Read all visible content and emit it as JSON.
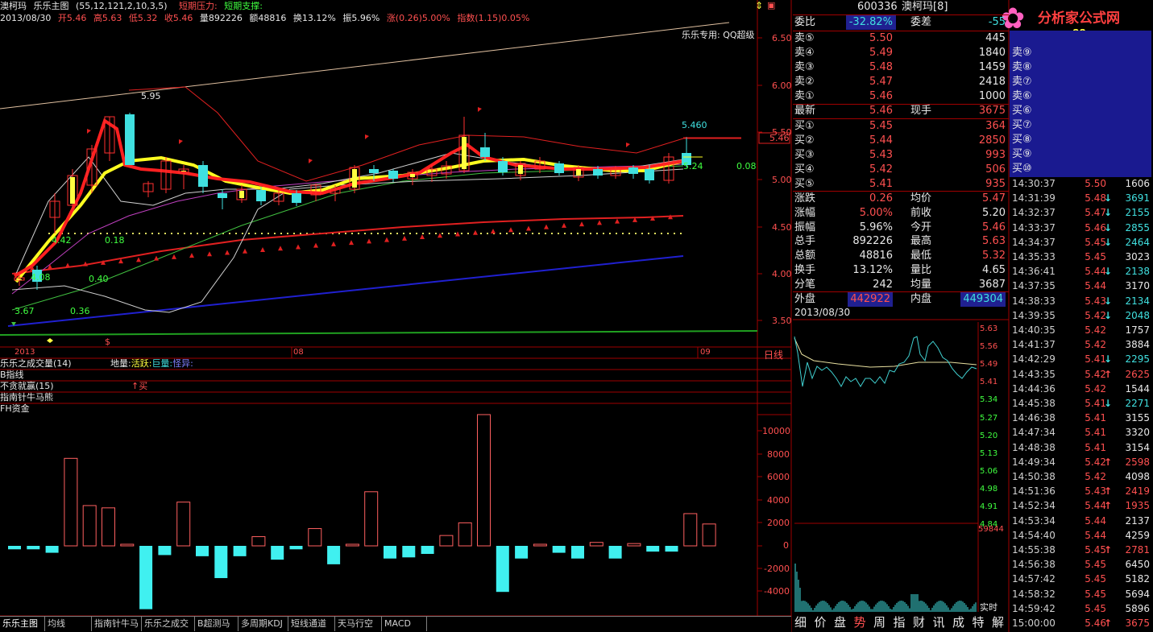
{
  "header": {
    "stock_name": "澳柯玛",
    "indicator_name": "乐乐主图",
    "params": "(55,12,121,2,10,3,5)",
    "pressure": "短期压力:",
    "support": "短期支撑:",
    "date": "2013/08/30",
    "open": "开5.46",
    "high": "高5.63",
    "low": "低5.32",
    "close": "收5.46",
    "volume": "量892226",
    "amount": "额48816",
    "turnover": "换13.12%",
    "swing": "振5.96%",
    "change": "涨(0.26)5.00%",
    "index": "指数(1.15)0.05%"
  },
  "main_chart": {
    "special_label": "乐乐专用: QQ超级",
    "y_ticks": [
      "6.50",
      "6.00",
      "5.50",
      "5.00",
      "4.50",
      "4.00",
      "3.50"
    ],
    "price_tags": {
      "high": "5.95",
      "low": "3.67",
      "last": "5.460",
      "cur_marker": "5.46",
      "right_val": "5.24",
      "green_val": "0.08"
    },
    "bottom_labels": {
      "lbl1": "0.18",
      "lbl2": "0.40",
      "lbl3": "0.36",
      "lbl4": "4.08",
      "lbl5": "4.42"
    },
    "x_labels": [
      "2013",
      "08",
      "09"
    ],
    "dayline": "日线"
  },
  "indicators": {
    "vol_title": "乐乐之成交量(14)",
    "vol_sub": [
      "地量:",
      "活跃:",
      "巨量:",
      "怪异:"
    ],
    "b_line": "B指线",
    "no_greedy": "不贪就赢(15)",
    "buy_mark": "↑买",
    "zhinan": "指南针牛马熊",
    "fh": "FH资金",
    "y_ticks": [
      "10000",
      "8000",
      "6000",
      "4000",
      "2000",
      "0",
      "-2000",
      "-4000"
    ]
  },
  "chart_data": {
    "type": "bar",
    "title": "乐乐之成交量(14)",
    "ylim": [
      -5500,
      12000
    ],
    "values": [
      -300,
      -300,
      -600,
      7600,
      3500,
      3300,
      0,
      -5500,
      -800,
      3800,
      -900,
      -2800,
      -900,
      800,
      -1200,
      -300,
      1500,
      -1600,
      100,
      4700,
      -1100,
      -1000,
      -700,
      900,
      2000,
      11400,
      -4000,
      -1100,
      0,
      -600,
      -1100,
      300,
      -1100,
      200,
      -500,
      -500,
      2800,
      1900
    ]
  },
  "order_book": {
    "code": "600336",
    "name": "澳柯玛[8]",
    "wb_label": "委比",
    "wb_val": "-32.82%",
    "wc_label": "委差",
    "wc_val": "-55",
    "sells": [
      {
        "l": "卖⑤",
        "p": "5.50",
        "v": "445"
      },
      {
        "l": "卖④",
        "p": "5.49",
        "v": "1840"
      },
      {
        "l": "卖③",
        "p": "5.48",
        "v": "1459"
      },
      {
        "l": "卖②",
        "p": "5.47",
        "v": "2418"
      },
      {
        "l": "卖①",
        "p": "5.46",
        "v": "1000"
      }
    ],
    "last": {
      "l": "最新",
      "p": "5.46",
      "m": "现手",
      "v": "3675"
    },
    "buys": [
      {
        "l": "买①",
        "p": "5.45",
        "v": "364"
      },
      {
        "l": "买②",
        "p": "5.44",
        "v": "2850"
      },
      {
        "l": "买③",
        "p": "5.43",
        "v": "993"
      },
      {
        "l": "买④",
        "p": "5.42",
        "v": "506"
      },
      {
        "l": "买⑤",
        "p": "5.41",
        "v": "935"
      }
    ],
    "stats": [
      {
        "l": "涨跌",
        "v": "0.26",
        "m": "均价",
        "mv": "5.47"
      },
      {
        "l": "涨幅",
        "v": "5.00%",
        "m": "前收",
        "mv": "5.20"
      },
      {
        "l": "振幅",
        "v": "5.96%",
        "m": "今开",
        "mv": "5.46"
      },
      {
        "l": "总手",
        "v": "892226",
        "m": "最高",
        "mv": "5.63"
      },
      {
        "l": "总额",
        "v": "48816",
        "m": "最低",
        "mv": "5.32"
      },
      {
        "l": "换手",
        "v": "13.12%",
        "m": "量比",
        "mv": "4.65"
      },
      {
        "l": "分笔",
        "v": "242",
        "m": "均量",
        "mv": "3687"
      }
    ],
    "outer": {
      "l": "外盘",
      "v": "442922",
      "m": "内盘",
      "mv": "449304"
    },
    "blue_sells": [
      "卖⑨",
      "卖⑧",
      "卖⑦",
      "卖⑥"
    ],
    "blue_buys": [
      "买⑥",
      "买⑦",
      "买⑧",
      "买⑨",
      "买⑩"
    ]
  },
  "mini_chart": {
    "date": "2013/08/30",
    "y_ticks": [
      "5.63",
      "5.56",
      "5.49",
      "5.41",
      "5.34",
      "5.27",
      "5.20",
      "5.13",
      "5.06",
      "4.98",
      "4.91",
      "4.84"
    ],
    "vol_max": "59844",
    "rt": "实时"
  },
  "ticks": [
    {
      "t": "14:30:37",
      "p": "5.50",
      "v": "1606",
      "c": "r",
      "a": ""
    },
    {
      "t": "14:31:39",
      "p": "5.48",
      "v": "3691",
      "c": "r",
      "a": "down"
    },
    {
      "t": "14:32:37",
      "p": "5.47",
      "v": "2155",
      "c": "r",
      "a": "down"
    },
    {
      "t": "14:33:37",
      "p": "5.46",
      "v": "2855",
      "c": "r",
      "a": "down"
    },
    {
      "t": "14:34:37",
      "p": "5.45",
      "v": "2464",
      "c": "r",
      "a": "down"
    },
    {
      "t": "14:35:33",
      "p": "5.45",
      "v": "3023",
      "c": "r",
      "a": ""
    },
    {
      "t": "14:36:41",
      "p": "5.44",
      "v": "2138",
      "c": "r",
      "a": "down"
    },
    {
      "t": "14:37:35",
      "p": "5.44",
      "v": "3170",
      "c": "r",
      "a": ""
    },
    {
      "t": "14:38:33",
      "p": "5.43",
      "v": "2134",
      "c": "r",
      "a": "down"
    },
    {
      "t": "14:39:35",
      "p": "5.42",
      "v": "2048",
      "c": "r",
      "a": "down"
    },
    {
      "t": "14:40:35",
      "p": "5.42",
      "v": "1757",
      "c": "r",
      "a": ""
    },
    {
      "t": "14:41:37",
      "p": "5.42",
      "v": "3884",
      "c": "r",
      "a": ""
    },
    {
      "t": "14:42:29",
      "p": "5.41",
      "v": "2295",
      "c": "r",
      "a": "down"
    },
    {
      "t": "14:43:35",
      "p": "5.42",
      "v": "2625",
      "c": "r",
      "a": "up"
    },
    {
      "t": "14:44:36",
      "p": "5.42",
      "v": "1544",
      "c": "r",
      "a": ""
    },
    {
      "t": "14:45:38",
      "p": "5.41",
      "v": "2271",
      "c": "r",
      "a": "down"
    },
    {
      "t": "14:46:38",
      "p": "5.41",
      "v": "3155",
      "c": "r",
      "a": ""
    },
    {
      "t": "14:47:34",
      "p": "5.41",
      "v": "3320",
      "c": "r",
      "a": ""
    },
    {
      "t": "14:48:38",
      "p": "5.41",
      "v": "3154",
      "c": "r",
      "a": ""
    },
    {
      "t": "14:49:34",
      "p": "5.42",
      "v": "2598",
      "c": "r",
      "a": "up"
    },
    {
      "t": "14:50:38",
      "p": "5.42",
      "v": "4098",
      "c": "r",
      "a": ""
    },
    {
      "t": "14:51:36",
      "p": "5.43",
      "v": "2419",
      "c": "r",
      "a": "up"
    },
    {
      "t": "14:52:34",
      "p": "5.44",
      "v": "1935",
      "c": "r",
      "a": "up"
    },
    {
      "t": "14:53:34",
      "p": "5.44",
      "v": "2137",
      "c": "r",
      "a": ""
    },
    {
      "t": "14:54:40",
      "p": "5.44",
      "v": "4259",
      "c": "r",
      "a": ""
    },
    {
      "t": "14:55:38",
      "p": "5.45",
      "v": "2781",
      "c": "r",
      "a": "up"
    },
    {
      "t": "14:56:38",
      "p": "5.45",
      "v": "6450",
      "c": "r",
      "a": ""
    },
    {
      "t": "14:57:42",
      "p": "5.45",
      "v": "5182",
      "c": "r",
      "a": ""
    },
    {
      "t": "14:58:32",
      "p": "5.45",
      "v": "5694",
      "c": "r",
      "a": ""
    },
    {
      "t": "14:59:42",
      "p": "5.45",
      "v": "5896",
      "c": "r",
      "a": ""
    },
    {
      "t": "15:00:00",
      "p": "5.46",
      "v": "3675",
      "c": "r",
      "a": "up"
    }
  ],
  "tabs": [
    "乐乐主图",
    "均线",
    "指南针牛马",
    "乐乐之成交",
    "B超测马",
    "多周期KDJ",
    "短线通道",
    "天马行空",
    "MACD"
  ],
  "bottom_tabs": [
    "细",
    "价",
    "盘",
    "势",
    "周",
    "指",
    "财",
    "讯",
    "成",
    "特",
    "解"
  ],
  "logo": {
    "title": "分析家公式网",
    "url": "www.88gs.com"
  }
}
